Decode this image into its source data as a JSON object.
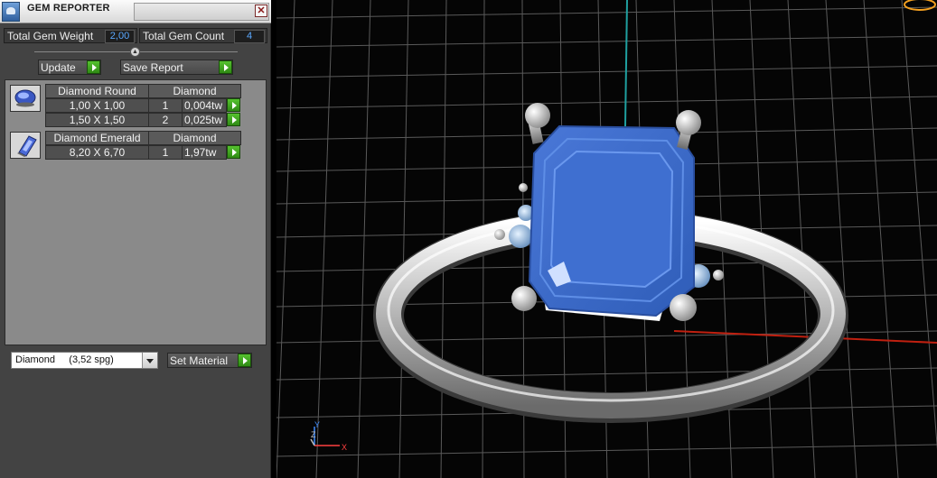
{
  "window": {
    "title": "GEM REPORTER",
    "close_glyph": "✕"
  },
  "summary": {
    "weight_label": "Total Gem Weight",
    "weight_value": "2,00",
    "count_label": "Total Gem Count",
    "count_value": "4"
  },
  "actions": {
    "update_label": "Update",
    "save_label": "Save Report"
  },
  "gems": [
    {
      "icon": "round-diamond-icon",
      "name": "Diamond Round",
      "material": "Diamond",
      "rows": [
        {
          "size": "1,00 X 1,00",
          "count": "1",
          "weight": "0,004tw"
        },
        {
          "size": "1,50 X 1,50",
          "count": "2",
          "weight": "0,025tw"
        }
      ]
    },
    {
      "icon": "emerald-diamond-icon",
      "name": "Diamond Emerald",
      "material": "Diamond",
      "rows": [
        {
          "size": "8,20 X 6,70",
          "count": "1",
          "weight": "1,97tw"
        }
      ]
    }
  ],
  "material_select": {
    "value": "Diamond     (3,52 spg)"
  },
  "set_material_label": "Set Material",
  "viewport": {
    "axis_x": "X",
    "axis_y": "Y",
    "axis_z": "Z",
    "colors": {
      "gem": "#3f6fd0",
      "metal": "#d9d9d9",
      "grid": "#5a5a5a",
      "axis_green": "#1fa0a0",
      "axis_red": "#c02010"
    }
  }
}
